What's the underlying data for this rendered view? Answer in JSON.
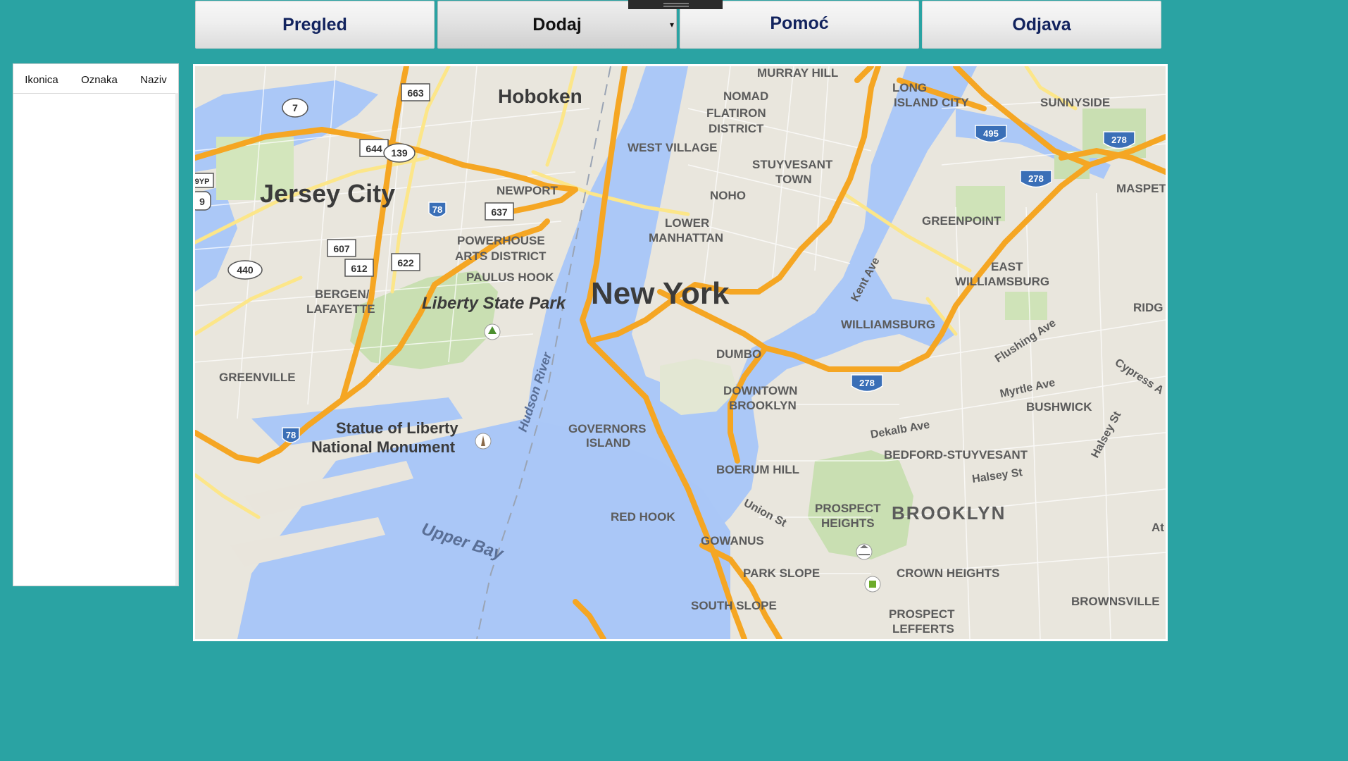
{
  "nav": {
    "pregled": "Pregled",
    "dodaj": "Dodaj",
    "pomoc": "Pomoć",
    "odjava": "Odjava"
  },
  "sidebar": {
    "columns": [
      "Ikonica",
      "Oznaka",
      "Naziv"
    ],
    "rows": []
  },
  "map": {
    "labels": {
      "hoboken": "Hoboken",
      "jersey_city": "Jersey City",
      "newport": "NEWPORT",
      "powerhouse": "POWERHOUSE",
      "arts_district": "ARTS DISTRICT",
      "paulus_hook": "PAULUS HOOK",
      "liberty_state_park": "Liberty State Park",
      "bergen": "BERGEN/",
      "lafayette": "LAFAYETTE",
      "greenville": "GREENVILLE",
      "statue_line1": "Statue of Liberty",
      "statue_line2": "National Monument",
      "upper_bay": "Upper Bay",
      "hudson_river": "Hudson River",
      "new_york": "New York",
      "west_village": "WEST VILLAGE",
      "murray_hill": "MURRAY HILL",
      "nomad": "NOMAD",
      "flatiron": "FLATIRON",
      "district": "DISTRICT",
      "stuyvesant": "STUYVESANT",
      "town": "TOWN",
      "noho": "NOHO",
      "lower": "LOWER",
      "manhattan": "MANHATTAN",
      "long_island_city_1": "LONG",
      "long_island_city_2": "ISLAND CITY",
      "sunnyside": "SUNNYSIDE",
      "maspeth": "MASPETH",
      "greenpoint": "GREENPOINT",
      "east": "EAST",
      "williamsburg_e": "WILLIAMSBURG",
      "williamsburg": "WILLIAMSBURG",
      "kent_ave": "Kent Ave",
      "flushing_ave": "Flushing Ave",
      "ridg": "RIDG",
      "dumbo": "DUMBO",
      "downtown": "DOWNTOWN",
      "brooklyn_dt": "BROOKLYN",
      "myrtle_ave": "Myrtle Ave",
      "cypress": "Cypress A",
      "bushwick": "BUSHWICK",
      "dekalb_ave": "Dekalb Ave",
      "halsey_st_v": "Halsey St",
      "bedford": "BEDFORD-STUYVESANT",
      "halsey_st": "Halsey St",
      "governors": "GOVERNORS",
      "island": "ISLAND",
      "boerum_hill": "BOERUM HILL",
      "red_hook": "RED HOOK",
      "union_st": "Union St",
      "prospect": "PROSPECT",
      "heights": "HEIGHTS",
      "brooklyn": "BROOKLYN",
      "gowanus": "GOWANUS",
      "park_slope": "PARK SLOPE",
      "crown_heights": "CROWN HEIGHTS",
      "south_slope": "SOUTH SLOPE",
      "prospect2": "PROSPECT",
      "lefferts": "LEFFERTS",
      "brownsville": "BROWNSVILLE",
      "at": "At"
    },
    "shields": [
      "663",
      "7",
      "644",
      "139",
      "78",
      "637",
      "607",
      "612",
      "622",
      "440",
      "78",
      "495",
      "278",
      "278",
      "278",
      "9",
      "9YP"
    ]
  }
}
